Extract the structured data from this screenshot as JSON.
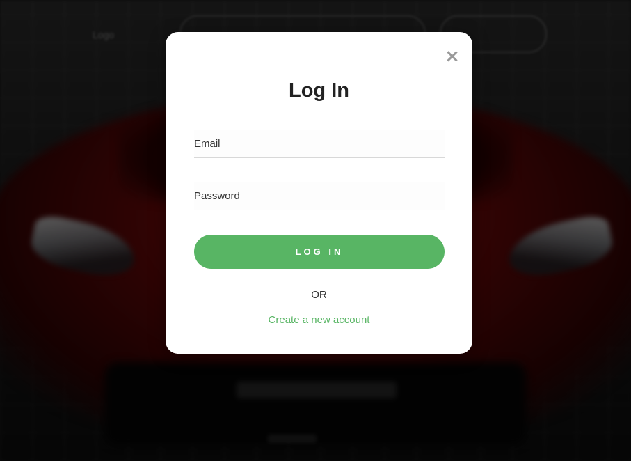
{
  "background": {
    "nav_link": "Logo"
  },
  "modal": {
    "close_icon": "×",
    "title": "Log In",
    "email": {
      "placeholder": "Email",
      "value": ""
    },
    "password": {
      "placeholder": "Password",
      "value": ""
    },
    "login_button_label": "LOG IN",
    "or_text": "OR",
    "create_account_link": "Create a new account"
  },
  "colors": {
    "accent": "#58b564",
    "modal_bg": "#ffffff",
    "title_text": "#222222",
    "close_icon": "#9a9a9a"
  }
}
